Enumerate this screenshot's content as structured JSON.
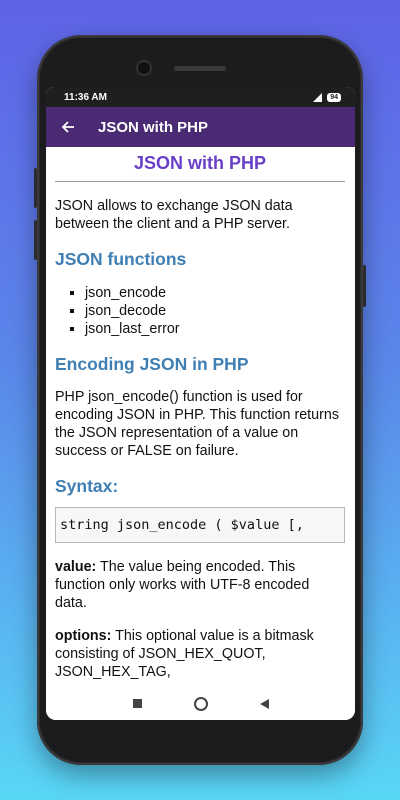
{
  "status": {
    "time": "11:36 AM",
    "battery": "94"
  },
  "appbar": {
    "title": "JSON with PHP"
  },
  "page": {
    "title": "JSON with PHP",
    "intro": "JSON allows to exchange JSON data between the client and a PHP server.",
    "functions_heading": "JSON functions",
    "functions": [
      "json_encode",
      "json_decode",
      "json_last_error"
    ],
    "encoding_heading": "Encoding JSON in PHP",
    "encoding_text": "PHP json_encode() function is used for encoding JSON in PHP. This function returns the JSON representation of a value on success or FALSE on failure.",
    "syntax_heading": "Syntax:",
    "syntax_code": "string json_encode ( $value [,",
    "value_label": "value:",
    "value_text": " The value being encoded. This function only works with UTF-8 encoded data.",
    "options_label": "options:",
    "options_text": " This optional value is a bitmask consisting of JSON_HEX_QUOT, JSON_HEX_TAG,"
  }
}
